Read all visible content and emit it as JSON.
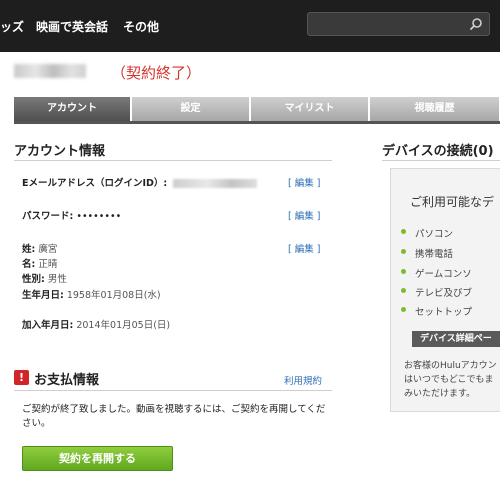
{
  "nav": {
    "items": [
      "ッズ",
      "映画で英会話",
      "その他"
    ],
    "search_placeholder": ""
  },
  "user": {
    "status": "（契約終了）"
  },
  "tabs": [
    "アカウント",
    "設定",
    "マイリスト",
    "視聴履歴"
  ],
  "account": {
    "title": "アカウント情報",
    "email_label": "Eメールアドレス（ログインID）:",
    "edit_label": "[ 編集 ]",
    "password_label": "パスワード:",
    "password_value": "••••••••",
    "last_name_label": "姓:",
    "last_name_value": "廣宮",
    "first_name_label": "名:",
    "first_name_value": "正晴",
    "gender_label": "性別:",
    "gender_value": "男性",
    "birthday_label": "生年月日:",
    "birthday_value": "1958年01月08日(水)",
    "joined_label": "加入年月日:",
    "joined_value": "2014年01月05日(日)"
  },
  "payment": {
    "title": "お支払情報",
    "terms_link": "利用規約",
    "message": "ご契約が終了致しました。動画を視聴するには、ご契約を再開してください。",
    "resume_button": "契約を再開する"
  },
  "devices": {
    "title": "デバイスの接続(0)",
    "available": "ご利用可能なデ",
    "items": [
      "パソコン",
      "携帯電話",
      "ゲームコンソ",
      "テレビ及びブ",
      "セットトップ"
    ],
    "details_button": "デバイス詳細ペー",
    "note_lines": [
      "お客様のHuluアカウン",
      "はいつでもどこでもま",
      "みいただけます。"
    ]
  },
  "colors": {
    "accent_red": "#d4342e",
    "link_blue": "#2f6fb5",
    "button_green": "#6fb828",
    "topbar": "#1e1e1e"
  }
}
